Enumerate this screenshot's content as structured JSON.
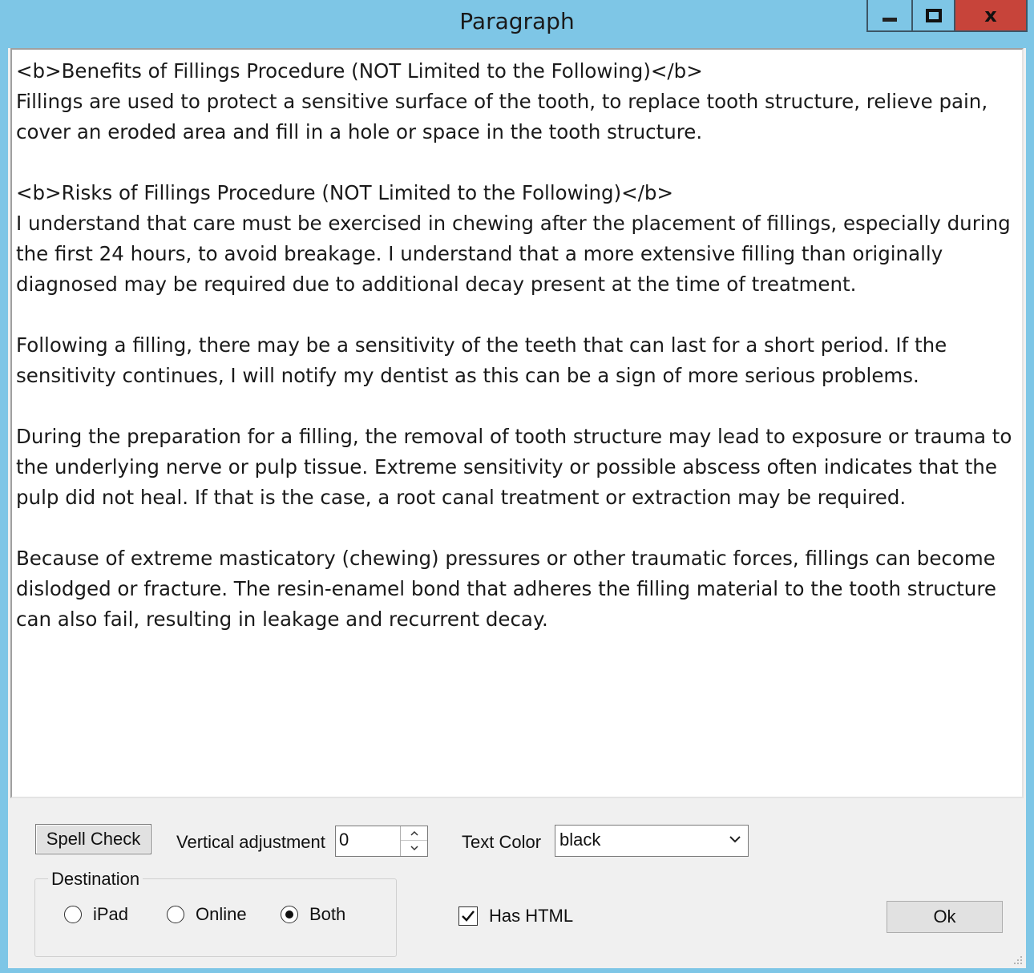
{
  "window": {
    "title": "Paragraph",
    "minimize_glyph": "minimize-icon",
    "maximize_glyph": "maximize-icon",
    "close_glyph": "x"
  },
  "editor": {
    "text": "<b>Benefits of Fillings Procedure (NOT Limited to the Following)</b>\nFillings are used to protect a sensitive surface of the tooth, to replace tooth structure, relieve pain, cover an eroded area and fill in a hole or space in the tooth structure.\n\n<b>Risks of Fillings Procedure (NOT Limited to the Following)</b>\nI understand that care must be exercised in chewing after the placement of fillings, especially during the first 24 hours, to avoid breakage. I understand that a more extensive filling than originally diagnosed may be required due to additional decay present at the time of treatment.\n\nFollowing a filling, there may be a sensitivity of the teeth that can last for a short period. If the sensitivity continues, I will notify my dentist as this can be a sign of more serious problems.\n\nDuring the preparation for a filling, the removal of tooth structure may lead to exposure or trauma to the underlying nerve or pulp tissue. Extreme sensitivity or possible abscess often indicates that the pulp did not heal. If that is the case, a root canal treatment or extraction may be required.\n\nBecause of extreme masticatory (chewing) pressures or other traumatic forces, fillings can become dislodged or fracture. The resin-enamel bond that adheres the filling material to the tooth structure can also fail, resulting in leakage and recurrent decay."
  },
  "controls": {
    "spell_check_label": "Spell Check",
    "vertical_adjustment_label": "Vertical adjustment",
    "vertical_adjustment_value": "0",
    "text_color_label": "Text Color",
    "text_color_value": "black",
    "destination": {
      "legend": "Destination",
      "options": [
        "iPad",
        "Online",
        "Both"
      ],
      "selected": "Both"
    },
    "has_html_label": "Has HTML",
    "has_html_checked": true,
    "ok_label": "Ok"
  },
  "colors": {
    "titlebar": "#7ec6e6",
    "close_button": "#c7443a",
    "dialog_bg": "#f0f0f0"
  }
}
